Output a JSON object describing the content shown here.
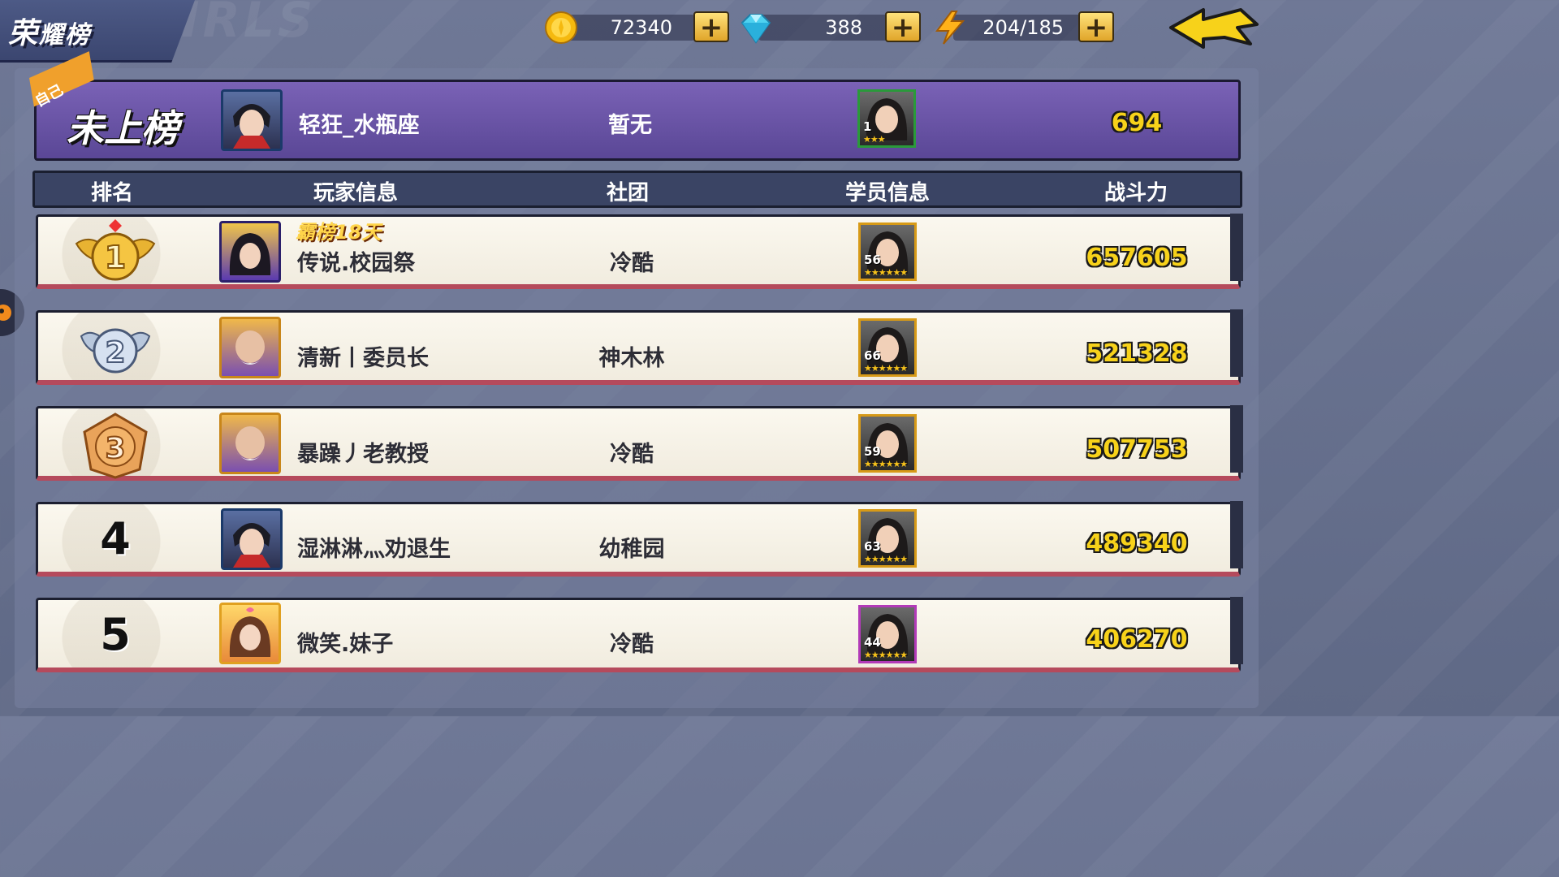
{
  "header": {
    "title_big": "荣",
    "title_small": "耀榜",
    "watermark": "GIRLS"
  },
  "resources": [
    {
      "icon": "gold-coin-icon",
      "value": "72340"
    },
    {
      "icon": "diamond-icon",
      "value": "388"
    },
    {
      "icon": "energy-bolt-icon",
      "value": "204/185"
    }
  ],
  "self": {
    "tag": "自己",
    "rank_text": "未上榜",
    "player_name": "轻狂_水瓶座",
    "club": "暂无",
    "student_level": "1",
    "student_stars": "★★★",
    "power": "694"
  },
  "columns": {
    "rank": "排名",
    "player": "玩家信息",
    "club": "社团",
    "student": "学员信息",
    "power": "战斗力"
  },
  "rows": [
    {
      "rank": "1",
      "badge": "霸榜18天",
      "player_name": "传说.校园祭",
      "club": "冷酷",
      "student_level": "56",
      "student_stars": "★★★★★★",
      "power": "657605"
    },
    {
      "rank": "2",
      "player_name": "清新丨委员长",
      "club": "神木林",
      "student_level": "66",
      "student_stars": "★★★★★★",
      "power": "521328"
    },
    {
      "rank": "3",
      "player_name": "暴躁丿老教授",
      "club": "冷酷",
      "student_level": "59",
      "student_stars": "★★★★★★",
      "power": "507753"
    },
    {
      "rank": "4",
      "player_name": "湿淋淋灬劝退生",
      "club": "幼稚园",
      "student_level": "63",
      "student_stars": "★★★★★★",
      "power": "489340"
    },
    {
      "rank": "5",
      "player_name": "微笑.妹子",
      "club": "冷酷",
      "student_level": "44",
      "student_stars": "★★★★★★",
      "power": "406270"
    }
  ]
}
